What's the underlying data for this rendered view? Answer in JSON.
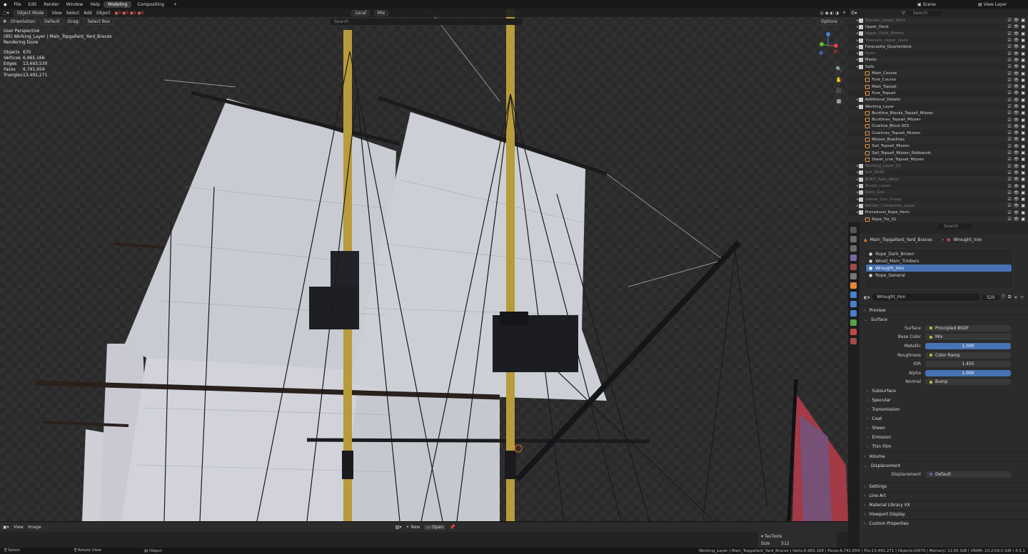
{
  "topbar": {
    "menus": [
      "File",
      "Edit",
      "Render",
      "Window",
      "Help"
    ],
    "workspaces": [
      "Modeling",
      "Compositing"
    ],
    "active_workspace": "Modeling",
    "scene": "Scene",
    "view_layer": "View Layer"
  },
  "viewport_header": {
    "mode": "Object Mode",
    "menus": [
      "View",
      "Select",
      "Add",
      "Object"
    ],
    "transform_orientation": "Local",
    "snap": "Mix",
    "orientation_label": "Orientation:",
    "orientation_value": "Default",
    "drag_label": "Drag:",
    "drag_value": "Select Box",
    "options": "Options",
    "search_placeholder": "Search"
  },
  "overlay": {
    "view": "User Perspective",
    "collection": "(95) Working_Layer | Main_Topgallant_Yard_Braces",
    "status": "Rendering Done"
  },
  "stats": [
    {
      "k": "Objects",
      "v": "670"
    },
    {
      "k": "Vertices",
      "v": "6,965,166"
    },
    {
      "k": "Edges",
      "v": "13,693,530"
    },
    {
      "k": "Faces",
      "v": "6,741,654"
    },
    {
      "k": "Triangles",
      "v": "13,491,271"
    }
  ],
  "image_editor": {
    "menus": [
      "View",
      "Image"
    ],
    "new": "New",
    "open": "Open",
    "panel_title": "TexTools",
    "size_label": "Size",
    "size_value": "512"
  },
  "outliner": {
    "search_placeholder": "Search",
    "rows": [
      {
        "name": "Trenails_Lower_Deck",
        "indent": 1,
        "dim": true
      },
      {
        "name": "Upper_Deck",
        "indent": 1
      },
      {
        "name": "Upper_Deck_Rooms",
        "indent": 1,
        "dim": true
      },
      {
        "name": "Treenails_Upper_Deck",
        "indent": 1,
        "dim": true
      },
      {
        "name": "Forecastle_Quarterdeck",
        "indent": 1
      },
      {
        "name": "Guns",
        "indent": 1,
        "dim": true
      },
      {
        "name": "Masts",
        "indent": 1
      },
      {
        "name": "Sails",
        "indent": 1
      },
      {
        "name": "Main_Course",
        "indent": 2
      },
      {
        "name": "Fore_Course",
        "indent": 2
      },
      {
        "name": "Main_Topsail",
        "indent": 2
      },
      {
        "name": "Fore_Topsail",
        "indent": 2
      },
      {
        "name": "Additional_Details",
        "indent": 1
      },
      {
        "name": "Working_Layer",
        "indent": 1
      },
      {
        "name": "Buntline_Blocks_Topsail_Mizzen",
        "indent": 2
      },
      {
        "name": "Buntlines_Topsail_Mizzen",
        "indent": 2
      },
      {
        "name": "Clueline_Block.003",
        "indent": 2
      },
      {
        "name": "Cluelines_Topsail_Mizzen",
        "indent": 2
      },
      {
        "name": "Mizzen_Bowlines",
        "indent": 2
      },
      {
        "name": "Sail_Topsail_Mizzen",
        "indent": 2
      },
      {
        "name": "Sail_Topsail_Mizzen_Robbands",
        "indent": 2
      },
      {
        "name": "Sheet_Line_Topsail_Mizzen",
        "indent": 2
      },
      {
        "name": "Working_Layer_02",
        "indent": 1,
        "dim": true
      },
      {
        "name": "Sail_BOKP",
        "indent": 1,
        "dim": true
      },
      {
        "name": "BOKP_Sails_Wind",
        "indent": 1,
        "dim": true
      },
      {
        "name": "Studio_Layer",
        "indent": 1,
        "dim": true
      },
      {
        "name": "Deck_Gun",
        "indent": 1,
        "dim": true
      },
      {
        "name": "Swivel_Gun_Group",
        "indent": 1,
        "dim": true
      },
      {
        "name": "Render_Composite_Layer",
        "indent": 1,
        "dim": true
      },
      {
        "name": "Procedural_Rope_Parts",
        "indent": 1
      },
      {
        "name": "Rope_Tie_01",
        "indent": 2
      }
    ]
  },
  "properties": {
    "object": "Main_Topgallant_Yard_Braces",
    "material": "Wrought_Iron",
    "search_placeholder": "Search",
    "slots": [
      "Rope_Dark_Brown",
      "Wood_Main_Timbers",
      "Wrought_Iron",
      "Rope_General"
    ],
    "selected_slot": "Wrought_Iron",
    "users": "520",
    "sections_top": [
      "Preview",
      "Surface"
    ],
    "surface_label": "Surface",
    "surface_value": "Principled BSDF",
    "rows": [
      {
        "label": "Base Color",
        "value": "Mix",
        "kind": "link"
      },
      {
        "label": "Metallic",
        "value": "1.000",
        "kind": "bar"
      },
      {
        "label": "Roughness",
        "value": "Color Ramp",
        "kind": "link"
      },
      {
        "label": "IOR",
        "value": "1.450",
        "kind": "num"
      },
      {
        "label": "Alpha",
        "value": "1.000",
        "kind": "bar"
      },
      {
        "label": "Normal",
        "value": "Bump",
        "kind": "link"
      }
    ],
    "subpanels": [
      "Subsurface",
      "Specular",
      "Transmission",
      "Coat",
      "Sheen",
      "Emission",
      "Thin Film"
    ],
    "volume": "Volume",
    "displacement": "Displacement",
    "displacement_label": "Displacement",
    "displacement_value": "Default",
    "bottom_sections": [
      "Settings",
      "Line Art",
      "Material Library VX",
      "Viewport Display",
      "Custom Properties"
    ]
  },
  "statusbar": {
    "left": [
      "Select",
      "Rotate View",
      "Object"
    ],
    "right": "Working_Layer | Main_Topgallant_Yard_Braces | Verts:6,965,166 | Faces:6,741,654 | Tris:13,491,271 | Objects:0/670 | Memory: 12.95 GiB | VRAM: 10.2/16.0 GiB | 4.3.1"
  }
}
